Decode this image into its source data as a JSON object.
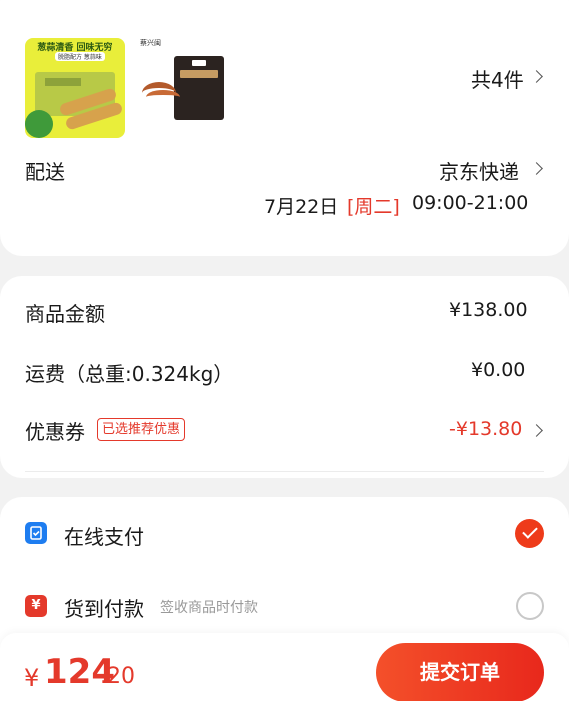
{
  "products": {
    "count_label": "共4件",
    "item1": {
      "headline": "葱蒜清香 回味无穷",
      "tag": "脱脂配方 葱蒜味",
      "brand_small": "茶·三"
    },
    "item2": {
      "brand": "蔡兴闽"
    }
  },
  "delivery": {
    "label": "配送",
    "carrier": "京东快递",
    "date": "7月22日",
    "weekday": "[周二]",
    "time": "09:00-21:00"
  },
  "summary": {
    "goods_label": "商品金额",
    "goods_value": "¥138.00",
    "freight_label": "运费（总重:0.324kg）",
    "freight_value": "¥0.00",
    "coupon_label": "优惠券",
    "coupon_badge": "已选推荐优惠",
    "coupon_value": "-¥13.80"
  },
  "payment": {
    "online_label": "在线支付",
    "cod_label": "货到付款",
    "cod_note": "签收商品时付款",
    "online_icon": "receipt-icon",
    "cod_icon": "yen-icon"
  },
  "footer": {
    "currency": "¥",
    "total_int": "124",
    "total_dec": ".20",
    "submit_label": "提交订单"
  },
  "colors": {
    "accent": "#e4392b",
    "primary_button": "#ee3b1a",
    "pay_blue": "#1e7df0"
  }
}
